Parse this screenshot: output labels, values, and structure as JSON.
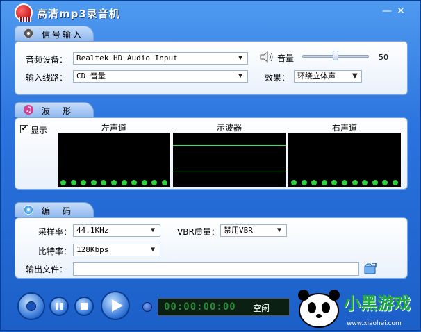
{
  "window": {
    "title": "高清mp3录音机",
    "minimize_glyph": "—",
    "close_glyph": "✕"
  },
  "signal_input": {
    "tab_label": "信号输入",
    "tab_icon": "speaker-disc-icon",
    "audio_device_label": "音频设备：",
    "audio_device_value": "Realtek HD Audio Input",
    "input_line_label": "输入线路：",
    "input_line_value": "CD 音量",
    "volume_label": "音量",
    "volume_value": "50",
    "volume_level_percent": 50,
    "effect_label": "效果：",
    "effect_value": "环绕立体声"
  },
  "waveform": {
    "tab_label": "波　形",
    "tab_icon": "music-note-icon",
    "show_label": "显示",
    "show_checked": true,
    "left_channel_label": "左声道",
    "oscilloscope_label": "示波器",
    "right_channel_label": "右声道"
  },
  "encoding": {
    "tab_label": "编　码",
    "tab_icon": "cd-disc-icon",
    "sample_rate_label": "采样率：",
    "sample_rate_value": "44.1KHz",
    "vbr_label": "VBR质量：",
    "vbr_value": "禁用VBR",
    "bitrate_label": "比特率：",
    "bitrate_value": "128Kbps",
    "output_file_label": "输出文件：",
    "output_file_value": "",
    "folder_icon": "folder-browse-icon"
  },
  "controls": {
    "record_icon": "record-icon",
    "pause_icon": "pause-icon",
    "stop_icon": "stop-icon",
    "play_icon": "play-icon",
    "indicator_icon": "status-dot-icon",
    "counter_digits": "00:00:00:00",
    "status_text": "空闲"
  },
  "watermark": {
    "brand_text": "小黑游戏",
    "site_text": "www.xiaohei.com"
  },
  "colors": {
    "frame_blue": "#2a72dd",
    "panel_bg": "#ffffff",
    "led_green": "#2fd13a",
    "scope_black": "#000000"
  }
}
